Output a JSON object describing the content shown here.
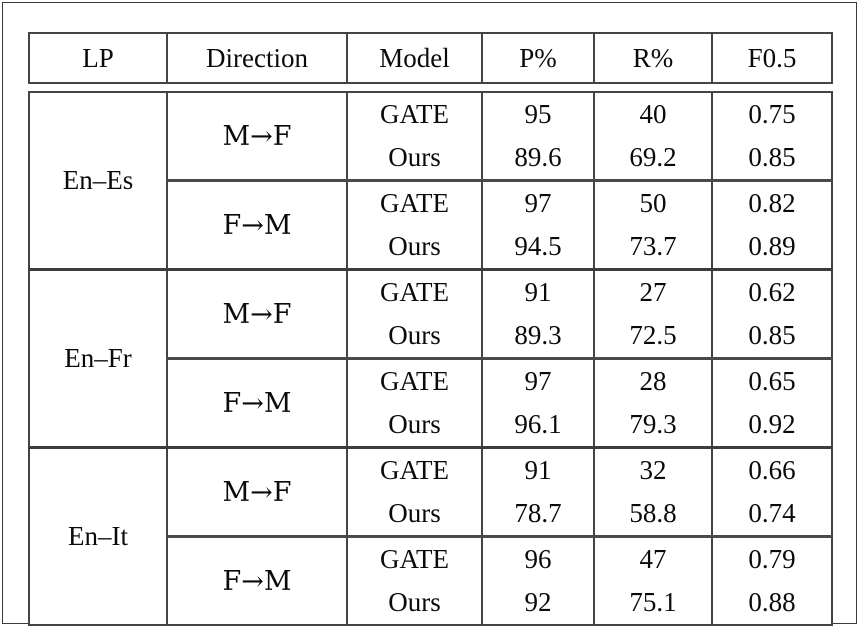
{
  "table": {
    "columns": [
      "LP",
      "Direction",
      "Model",
      "P%",
      "R%",
      "F0.5"
    ],
    "blocks": [
      {
        "lp": "En–Es",
        "pairs": [
          {
            "direction": "M→F",
            "rows": [
              {
                "model": "GATE",
                "p": "95",
                "r": "40",
                "f": "0.75",
                "bold": [
                  "p"
                ]
              },
              {
                "model": "Ours",
                "p": "89.6",
                "r": "69.2",
                "f": "0.85",
                "bold": [
                  "r",
                  "f"
                ]
              }
            ]
          },
          {
            "direction": "F→M",
            "rows": [
              {
                "model": "GATE",
                "p": "97",
                "r": "50",
                "f": "0.82",
                "bold": [
                  "p"
                ]
              },
              {
                "model": "Ours",
                "p": "94.5",
                "r": "73.7",
                "f": "0.89",
                "bold": [
                  "r",
                  "f"
                ]
              }
            ]
          }
        ]
      },
      {
        "lp": "En–Fr",
        "pairs": [
          {
            "direction": "M→F",
            "rows": [
              {
                "model": "GATE",
                "p": "91",
                "r": "27",
                "f": "0.62",
                "bold": [
                  "p"
                ]
              },
              {
                "model": "Ours",
                "p": "89.3",
                "r": "72.5",
                "f": "0.85",
                "bold": [
                  "r",
                  "f"
                ]
              }
            ]
          },
          {
            "direction": "F→M",
            "rows": [
              {
                "model": "GATE",
                "p": "97",
                "r": "28",
                "f": "0.65",
                "bold": [
                  "p"
                ]
              },
              {
                "model": "Ours",
                "p": "96.1",
                "r": "79.3",
                "f": "0.92",
                "bold": [
                  "r",
                  "f"
                ]
              }
            ]
          }
        ]
      },
      {
        "lp": "En–It",
        "pairs": [
          {
            "direction": "M→F",
            "rows": [
              {
                "model": "GATE",
                "p": "91",
                "r": "32",
                "f": "0.66",
                "bold": [
                  "p"
                ]
              },
              {
                "model": "Ours",
                "p": "78.7",
                "r": "58.8",
                "f": "0.74",
                "bold": [
                  "r",
                  "f"
                ]
              }
            ]
          },
          {
            "direction": "F→M",
            "rows": [
              {
                "model": "GATE",
                "p": "96",
                "r": "47",
                "f": "0.79",
                "bold": [
                  "p"
                ]
              },
              {
                "model": "Ours",
                "p": "92",
                "r": "75.1",
                "f": "0.88",
                "bold": [
                  "r",
                  "f"
                ]
              }
            ]
          }
        ]
      }
    ]
  }
}
